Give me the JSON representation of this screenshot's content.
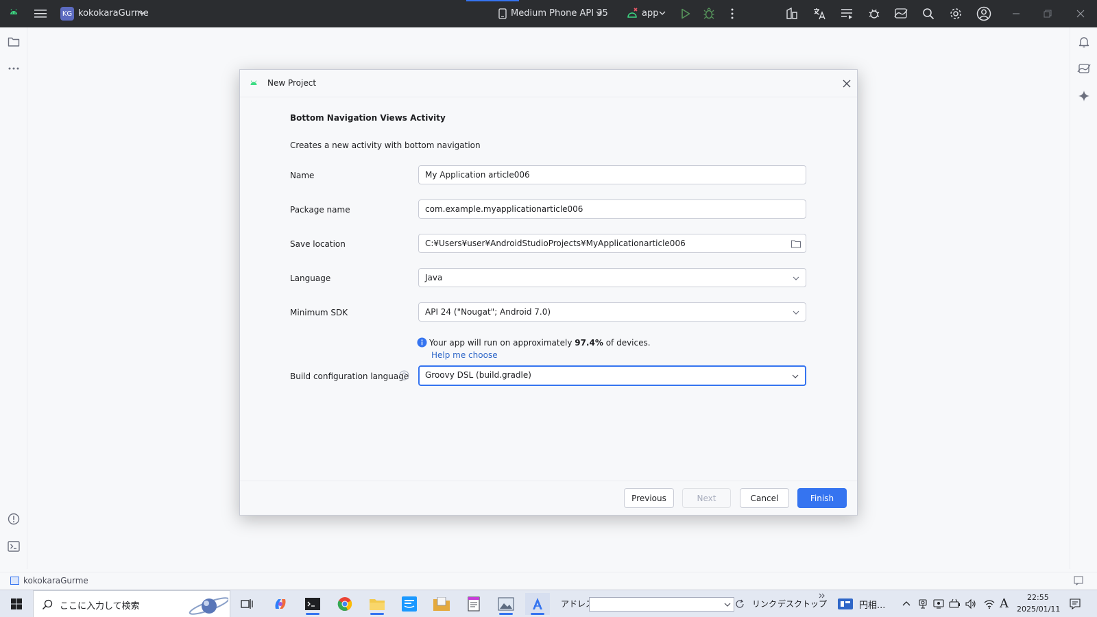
{
  "titlebar": {
    "project_badge": "KG",
    "project_name": "kokokaraGurme",
    "device": "Medium Phone API 35",
    "run_config": "app"
  },
  "dialog": {
    "title": "New Project",
    "template_title": "Bottom Navigation Views Activity",
    "description": "Creates a new activity with bottom navigation",
    "fields": {
      "name": {
        "label": "Name",
        "value": "My Application article006"
      },
      "package": {
        "label": "Package name",
        "value": "com.example.myapplicationarticle006"
      },
      "location": {
        "label": "Save location",
        "value": "C:¥Users¥user¥AndroidStudioProjects¥MyApplicationarticle006"
      },
      "language": {
        "label": "Language",
        "value": "Java"
      },
      "min_sdk": {
        "label": "Minimum SDK",
        "value": "API 24 (\"Nougat\"; Android 7.0)"
      },
      "build_config": {
        "label": "Build configuration language",
        "value": "Groovy DSL (build.gradle)"
      }
    },
    "info": {
      "prefix": "Your app will run on approximately ",
      "percent": "97.4%",
      "suffix": " of devices.",
      "help_link": "Help me choose"
    },
    "buttons": {
      "previous": "Previous",
      "next": "Next",
      "cancel": "Cancel",
      "finish": "Finish"
    }
  },
  "statusbar": {
    "project": "kokokaraGurme"
  },
  "taskbar": {
    "search_placeholder": "ここに入力して検索",
    "address_label": "アドレス",
    "links_label": "リンク",
    "desktop_label": "デスクトップ",
    "tray_app_label": "円相...",
    "ime": "A",
    "time": "22:55",
    "date": "2025/01/11"
  },
  "colors": {
    "accent": "#3574f0",
    "android_green": "#3ddc84",
    "titlebar_bg": "#2b2d30"
  }
}
